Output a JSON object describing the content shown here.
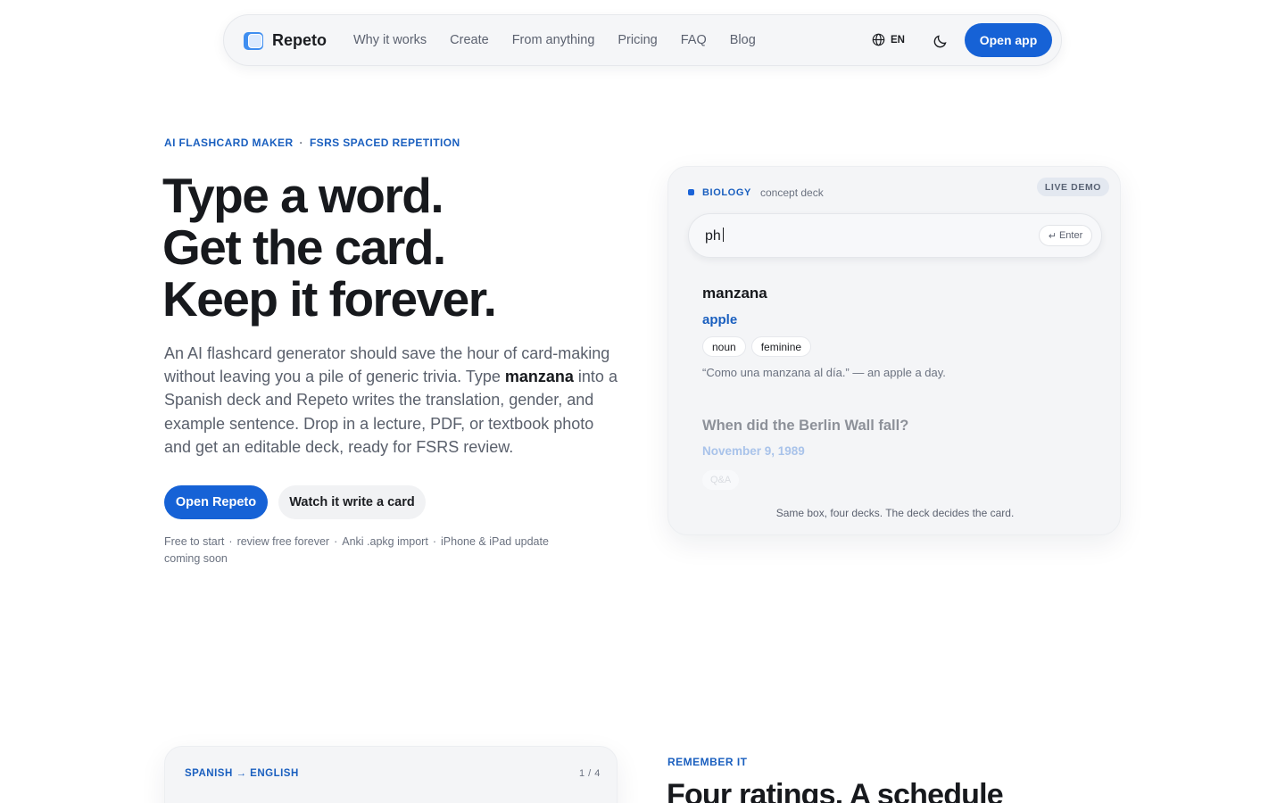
{
  "nav": {
    "brand": "Repeto",
    "links": [
      "Why it works",
      "Create",
      "From anything",
      "Pricing",
      "FAQ",
      "Blog"
    ],
    "lang_code": "EN",
    "open_app_label": "Open app",
    "icons": {
      "logo": "cards-logo-icon",
      "lang": "globe-icon",
      "theme": "moon-icon"
    }
  },
  "hero": {
    "eyebrow_1": "AI FLASHCARD MAKER",
    "eyebrow_sep": "·",
    "eyebrow_2": "FSRS SPACED REPETITION",
    "headline": [
      "Type a word.",
      "Get the card.",
      "Keep it forever."
    ],
    "lead_1": "An AI flashcard generator should save the hour of card-making without leaving you a pile of generic trivia. Type ",
    "lead_bold": "manzana",
    "lead_2": " into a Spanish deck and Repeto writes the translation, gender, and example sentence. Drop in a lecture, PDF, or textbook photo and get an editable deck, ready for FSRS review.",
    "primary_cta": "Open Repeto",
    "secondary_cta": "Watch it write a card",
    "perks": [
      "Free to start",
      "review free forever",
      "Anki .apkg import",
      "iPhone & iPad update coming soon"
    ],
    "perk_sep": "·"
  },
  "demo": {
    "subject": "BIOLOGY",
    "deck_type": "concept deck",
    "badge": "LIVE DEMO",
    "typed": "ph",
    "enter_glyph": "↵",
    "enter_label": "Enter",
    "card1": {
      "term": "manzana",
      "translation": "apple",
      "tags": [
        "noun",
        "feminine"
      ],
      "example": "“Como una manzana al día.” — an apple a day."
    },
    "card2": {
      "question": "When did the Berlin Wall fall?",
      "answer": "November 9, 1989",
      "tag": "Q&A"
    },
    "caption": "Same box, four decks. The deck decides the card.",
    "accent_color": "#1662d6"
  },
  "lower": {
    "pair_label": "SPANISH → ENGLISH",
    "count": "1 / 4",
    "eyebrow": "REMEMBER IT",
    "heading": "Four ratings. A schedule"
  }
}
